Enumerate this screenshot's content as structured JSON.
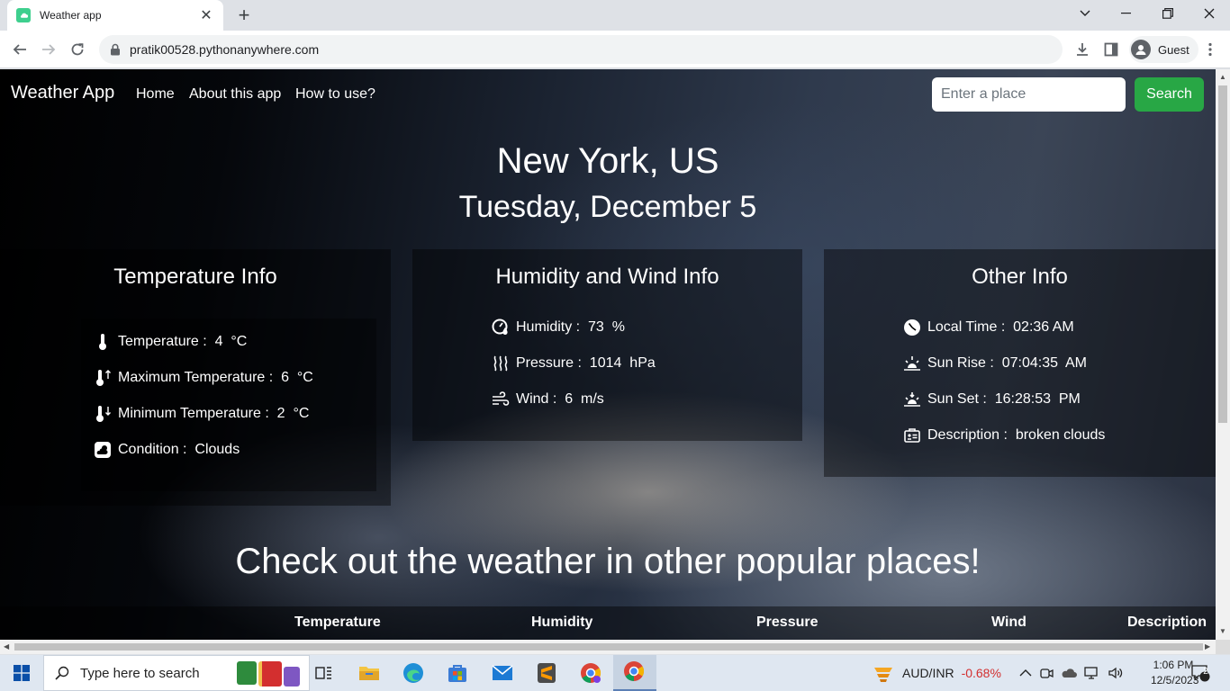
{
  "browser": {
    "tab_title": "Weather app",
    "new_tab_symbol": "+",
    "url": "pratik00528.pythonanywhere.com",
    "profile_label": "Guest"
  },
  "app": {
    "brand": "Weather App",
    "nav": [
      "Home",
      "About this app",
      "How to use?"
    ],
    "search_placeholder": "Enter a place",
    "search_button": "Search",
    "city": "New York, US",
    "date": "Tuesday, December 5"
  },
  "temperature_card": {
    "title": "Temperature Info",
    "rows": [
      {
        "icon": "thermometer-icon",
        "text": "Temperature :  4  °C"
      },
      {
        "icon": "thermometer-up-icon",
        "text": "Maximum Temperature :  6  °C"
      },
      {
        "icon": "thermometer-down-icon",
        "text": "Minimum Temperature :  2  °C"
      },
      {
        "icon": "cloud-sun-icon",
        "text": "Condition :  Clouds"
      }
    ]
  },
  "humidity_card": {
    "title": "Humidity and Wind Info",
    "rows": [
      {
        "icon": "humidity-icon",
        "text": "Humidity :  73  %"
      },
      {
        "icon": "pressure-icon",
        "text": "Pressure :  1014  hPa"
      },
      {
        "icon": "wind-icon",
        "text": "Wind :  6  m/s"
      }
    ]
  },
  "other_card": {
    "title": "Other Info",
    "rows": [
      {
        "icon": "clock-icon",
        "text": "Local Time :  02:36 AM"
      },
      {
        "icon": "sunrise-icon",
        "text": "Sun Rise :  07:04:35  AM"
      },
      {
        "icon": "sunset-icon",
        "text": "Sun Set :  16:28:53  PM"
      },
      {
        "icon": "description-icon",
        "text": "Description :  broken clouds"
      }
    ]
  },
  "popular": {
    "title": "Check out the weather in other popular places!",
    "columns": [
      "Temperature",
      "Humidity",
      "Pressure",
      "Wind",
      "Description"
    ]
  },
  "taskbar": {
    "search_placeholder": "Type here to search",
    "ticker_symbol": "AUD/INR",
    "ticker_change": "-0.68%",
    "time": "1:06 PM",
    "date": "12/5/2023",
    "notification_count": "2"
  },
  "colors": {
    "search_button": "#28a745",
    "ticker_negative": "#d32f2f"
  }
}
